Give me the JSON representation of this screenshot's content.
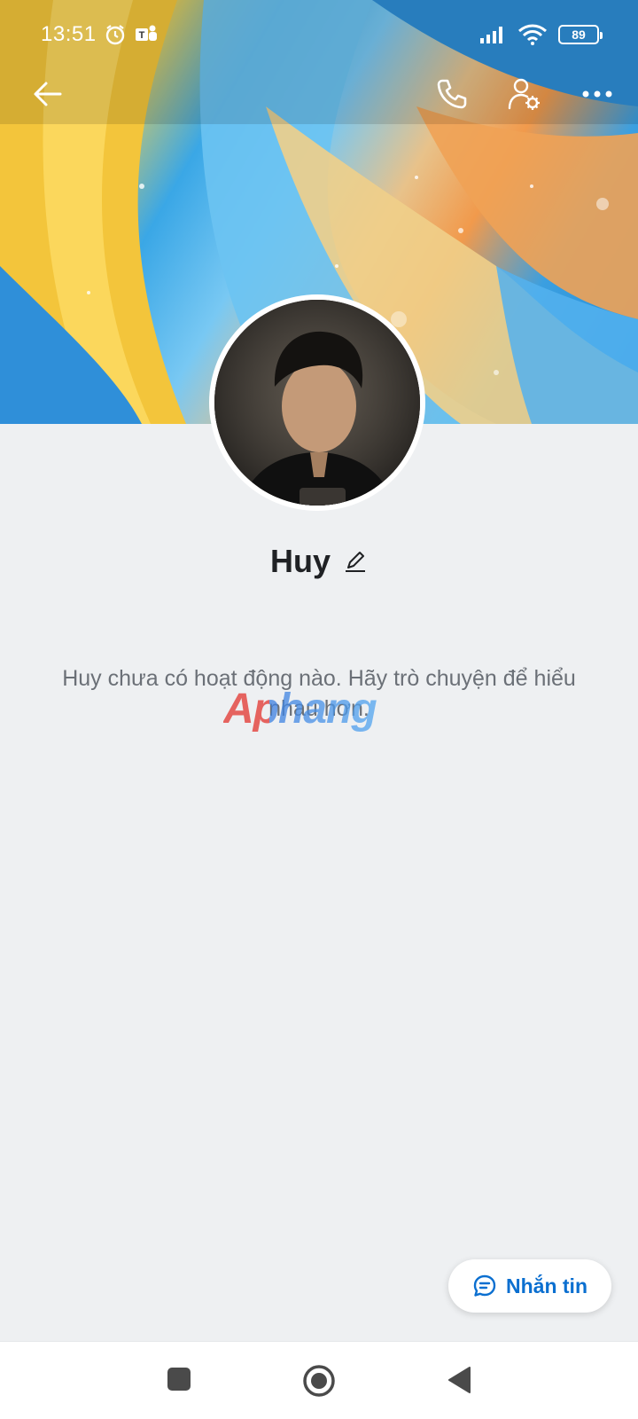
{
  "status_bar": {
    "time": "13:51",
    "battery": "89",
    "icons": [
      "alarm-icon",
      "teams-icon",
      "signal-icon",
      "wifi-icon",
      "battery-icon"
    ]
  },
  "top_nav": {
    "icons": [
      "back-arrow-icon",
      "phone-icon",
      "profile-settings-icon",
      "more-icon"
    ]
  },
  "profile": {
    "name": "Huy",
    "empty_message": "Huy chưa có hoạt động nào. Hãy trò chuyện để hiểu nhau hơn."
  },
  "watermark": "Aphang",
  "actions": {
    "message_label": "Nhắn tin"
  },
  "colors": {
    "accent": "#0b6fd0",
    "background": "#eef0f2"
  }
}
